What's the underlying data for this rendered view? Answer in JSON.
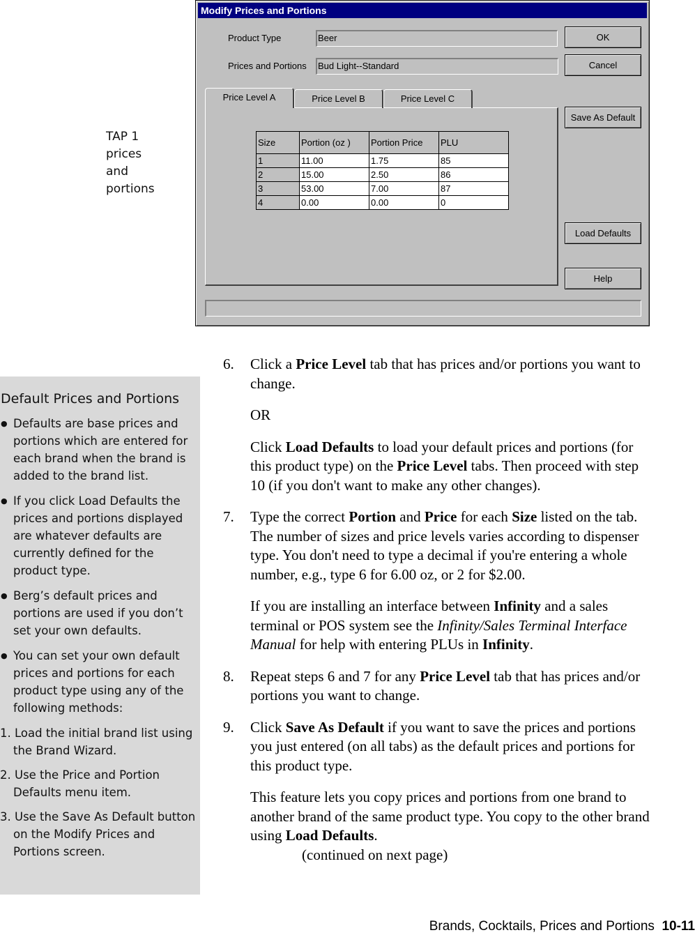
{
  "dialog": {
    "title": "Modify Prices and Portions",
    "product_type_label": "Product Type",
    "product_type_value": "Beer",
    "prices_label": "Prices and Portions",
    "prices_value": "Bud Light--Standard",
    "buttons": {
      "ok": "OK",
      "cancel": "Cancel",
      "save_default": "Save As Default",
      "load_defaults": "Load Defaults",
      "help": "Help"
    },
    "tabs": [
      "Price Level A",
      "Price Level B",
      "Price Level C"
    ],
    "table": {
      "headers": [
        "Size",
        "Portion (oz  )",
        "Portion Price",
        "PLU"
      ],
      "rows": [
        [
          "1",
          "11.00",
          "1.75",
          "85"
        ],
        [
          "2",
          "15.00",
          "2.50",
          "86"
        ],
        [
          "3",
          "53.00",
          "7.00",
          "87"
        ],
        [
          "4",
          "0.00",
          "0.00",
          "0"
        ]
      ]
    }
  },
  "margin_note": [
    "TAP 1",
    "prices",
    "and",
    "portions"
  ],
  "sidebar": {
    "title": "Default Prices and Portions",
    "bullets": [
      "Defaults are base prices and portions which are entered for each brand when the brand is added to the brand list.",
      "If you click Load Defaults the prices and portions displayed are whatever defaults are currently defined for the product type.",
      "Berg’s default prices and portions are used if you don’t set your own defaults.",
      "You can set your own default prices and portions for each product type using any of the following methods:"
    ],
    "methods": [
      "1. Load the initial brand list using the Brand Wizard.",
      "2. Use the Price and Portion Defaults menu item.",
      "3. Use the Save As Default button on the Modify Prices and Portions screen."
    ]
  },
  "main": [
    {
      "n": "6.",
      "seg": [
        [
          "Click a ",
          ""
        ],
        [
          "Price Level",
          "b"
        ],
        [
          " tab that has prices and/or portions you want to change.",
          ""
        ]
      ]
    },
    {
      "seg": [
        [
          "OR",
          ""
        ]
      ]
    },
    {
      "seg": [
        [
          "Click ",
          ""
        ],
        [
          "Load Defaults",
          "b"
        ],
        [
          " to load your default prices and portions (for this product type) on the ",
          ""
        ],
        [
          "Price Level",
          "b"
        ],
        [
          " tabs. Then proceed with step 10 (if you don't want to make any other changes).",
          ""
        ]
      ]
    },
    {
      "n": "7.",
      "seg": [
        [
          "Type the correct ",
          ""
        ],
        [
          "Portion",
          "b"
        ],
        [
          " and ",
          ""
        ],
        [
          "Price",
          "b"
        ],
        [
          " for each ",
          ""
        ],
        [
          "Size",
          "b"
        ],
        [
          " listed on the tab. The number of sizes and price levels varies according to dispenser type. You don't need to type a decimal if you're entering a whole number, e.g., type 6 for 6.00 oz, or 2 for $2.00.",
          ""
        ]
      ]
    },
    {
      "seg": [
        [
          "If you are installing an interface between ",
          ""
        ],
        [
          "Infinity",
          "b"
        ],
        [
          " and a sales terminal or POS system see the ",
          ""
        ],
        [
          "Infinity/Sales Terminal Interface Manual",
          "i"
        ],
        [
          " for help with entering PLUs in ",
          ""
        ],
        [
          "Infinity",
          "b"
        ],
        [
          ".",
          ""
        ]
      ]
    },
    {
      "n": "8.",
      "seg": [
        [
          "Repeat steps 6 and 7 for any ",
          ""
        ],
        [
          "Price Level",
          "b"
        ],
        [
          " tab that has prices and/or portions you want to change.",
          ""
        ]
      ]
    },
    {
      "n": "9.",
      "seg": [
        [
          "Click ",
          ""
        ],
        [
          "Save As Default",
          "b"
        ],
        [
          " if you want to save the prices and portions you just entered (on all tabs) as the default prices and portions for this product type.",
          ""
        ]
      ]
    },
    {
      "seg": [
        [
          "This feature lets you copy prices and portions from one brand to another brand of the same product type. You copy to the other brand using ",
          ""
        ],
        [
          "Load Defaults",
          "b"
        ],
        [
          ".",
          ""
        ]
      ]
    }
  ],
  "continued": "(continued on next page)",
  "footer": {
    "text": "Brands, Cocktails, Prices and Portions",
    "page": "10-11"
  }
}
